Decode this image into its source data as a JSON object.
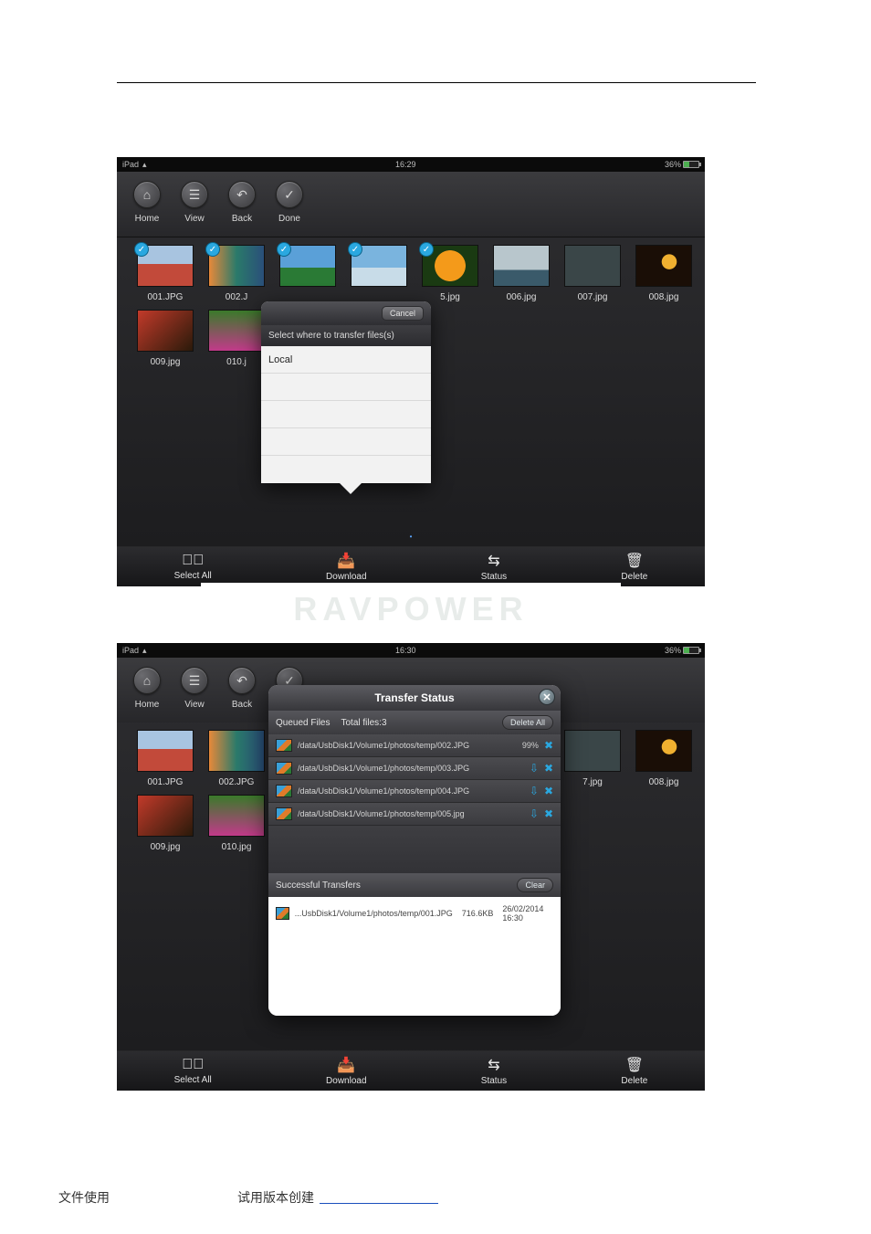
{
  "doc": {
    "footer_left": "文件使用",
    "footer_mid": "试用版本创建"
  },
  "watermark": "RAVPOWER",
  "statusbar": {
    "device": "iPad",
    "time1": "16:29",
    "time2": "16:30",
    "battery_pct": "36%"
  },
  "toolbar": {
    "home": "Home",
    "view": "View",
    "back": "Back",
    "done": "Done"
  },
  "bottombar": {
    "select_all": "Select All",
    "download": "Download",
    "status": "Status",
    "delete": "Delete"
  },
  "popover": {
    "cancel": "Cancel",
    "prompt": "Select where to transfer files(s)",
    "option1": "Local"
  },
  "files1": [
    {
      "name": "001.JPG",
      "checked": true
    },
    {
      "name": "002.J",
      "checked": true
    },
    {
      "name": "",
      "checked": true
    },
    {
      "name": "",
      "checked": true
    },
    {
      "name": "5.jpg",
      "checked": true
    },
    {
      "name": "006.jpg",
      "checked": false
    },
    {
      "name": "007.jpg",
      "checked": false
    },
    {
      "name": "008.jpg",
      "checked": false
    },
    {
      "name": "009.jpg",
      "checked": false
    },
    {
      "name": "010.j",
      "checked": false
    }
  ],
  "files2": [
    {
      "name": "001.JPG"
    },
    {
      "name": "002.JPG"
    },
    {
      "name": ""
    },
    {
      "name": ""
    },
    {
      "name": ""
    },
    {
      "name": ""
    },
    {
      "name": "7.jpg"
    },
    {
      "name": "008.jpg"
    },
    {
      "name": "009.jpg"
    },
    {
      "name": "010.jpg"
    }
  ],
  "transfer": {
    "title": "Transfer Status",
    "queued_label": "Queued Files",
    "total_label": "Total files:3",
    "delete_all": "Delete All",
    "clear": "Clear",
    "successful_label": "Successful Transfers",
    "queued": [
      {
        "path": "/data/UsbDisk1/Volume1/photos/temp/002.JPG",
        "pct": "99%"
      },
      {
        "path": "/data/UsbDisk1/Volume1/photos/temp/003.JPG",
        "pct": ""
      },
      {
        "path": "/data/UsbDisk1/Volume1/photos/temp/004.JPG",
        "pct": ""
      },
      {
        "path": "/data/UsbDisk1/Volume1/photos/temp/005.jpg",
        "pct": ""
      }
    ],
    "success": [
      {
        "path": "...UsbDisk1/Volume1/photos/temp/001.JPG",
        "size": "716.6KB",
        "date": "26/02/2014 16:30"
      }
    ]
  }
}
